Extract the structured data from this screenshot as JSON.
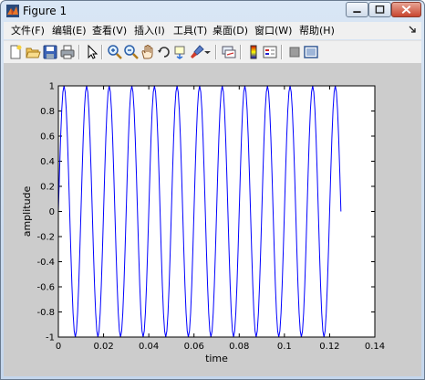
{
  "window": {
    "title": "Figure 1"
  },
  "menu": [
    {
      "label": "文件(F)"
    },
    {
      "label": "编辑(E)"
    },
    {
      "label": "查看(V)"
    },
    {
      "label": "插入(I)"
    },
    {
      "label": "工具(T)"
    },
    {
      "label": "桌面(D)"
    },
    {
      "label": "窗口(W)"
    },
    {
      "label": "帮助(H)"
    }
  ],
  "toolbar_icons": [
    "new-figure-icon",
    "open-file-icon",
    "save-icon",
    "print-icon",
    "edit-plot-arrow-icon",
    "zoom-in-icon",
    "zoom-out-icon",
    "pan-hand-icon",
    "rotate-3d-icon",
    "data-cursor-icon",
    "brush-icon",
    "link-plot-icon",
    "colorbar-icon",
    "legend-icon",
    "hide-plot-tools-icon",
    "show-plot-tools-icon"
  ],
  "colors": {
    "line": "#0000ff",
    "figure_bg": "#cccccc",
    "axes_bg": "#ffffff"
  },
  "chart_data": {
    "type": "line",
    "title": "",
    "xlabel": "time",
    "ylabel": "amplitude",
    "xlim": [
      0,
      0.14
    ],
    "ylim": [
      -1,
      1
    ],
    "x_ticks": [
      "0",
      "0.02",
      "0.04",
      "0.06",
      "0.08",
      "0.1",
      "0.12",
      "0.14"
    ],
    "y_ticks": [
      "-1",
      "-0.8",
      "-0.6",
      "-0.4",
      "-0.2",
      "0",
      "0.2",
      "0.4",
      "0.6",
      "0.8",
      "1"
    ],
    "grid": false,
    "series": [
      {
        "signal": "sine",
        "frequency_hz": 100,
        "amplitude": 1,
        "t_start": 0,
        "t_end": 0.125,
        "sample_step": 0.0005
      }
    ]
  }
}
